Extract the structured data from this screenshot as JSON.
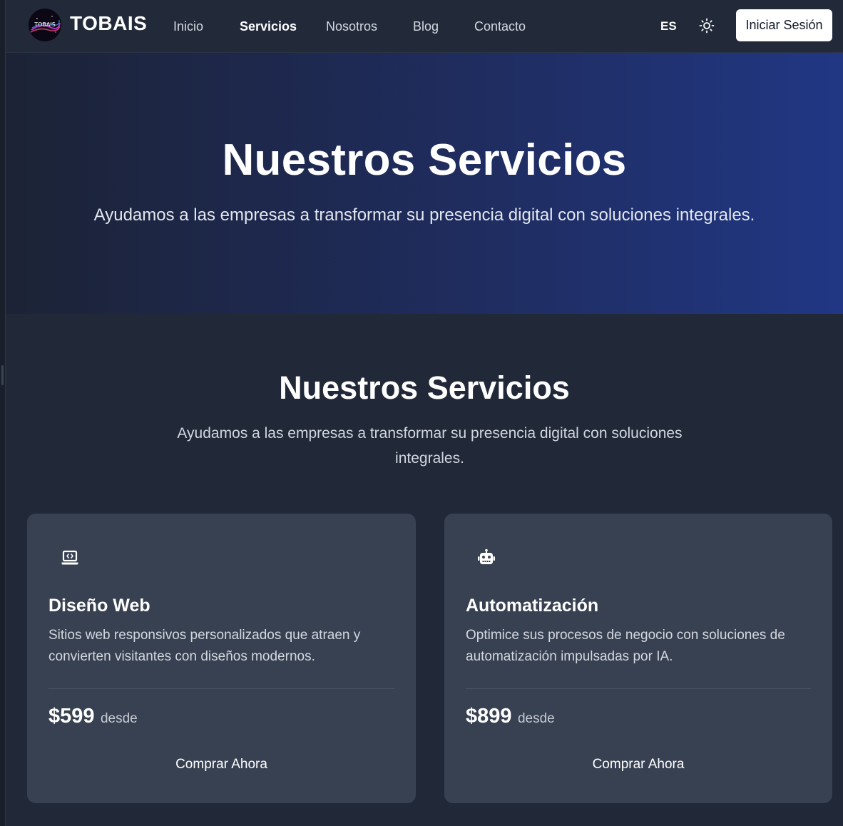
{
  "navbar": {
    "brand": "TOBAIS",
    "logo_text": "TOBAIS",
    "links": [
      {
        "label": "Inicio",
        "active": false
      },
      {
        "label": "Servicios",
        "active": true
      },
      {
        "label": "Nosotros",
        "active": false
      },
      {
        "label": "Blog",
        "active": false
      },
      {
        "label": "Contacto",
        "active": false
      }
    ],
    "language": "ES",
    "theme_icon": "sun-icon",
    "login_label": "Iniciar Sesión"
  },
  "hero": {
    "title": "Nuestros Servicios",
    "subtitle": "Ayudamos a las empresas a transformar su presencia digital con soluciones integrales."
  },
  "services": {
    "title": "Nuestros Servicios",
    "subtitle": "Ayudamos a las empresas a transformar su presencia digital con soluciones integrales.",
    "cards": [
      {
        "icon": "laptop-code-icon",
        "title": "Diseño Web",
        "description": "Sitios web responsivos personalizados que atraen y convierten visitantes con diseños modernos.",
        "price": "$599",
        "price_suffix": "desde",
        "button_label": "Comprar Ahora"
      },
      {
        "icon": "robot-icon",
        "title": "Automatización",
        "description": "Optimice sus procesos de negocio con soluciones de automatización impulsadas por IA.",
        "price": "$899",
        "price_suffix": "desde",
        "button_label": "Comprar Ahora"
      }
    ]
  },
  "colors": {
    "background": "#212938",
    "navbar": "#222a39",
    "card": "#384151",
    "hero_gradient_start": "#1c2336",
    "hero_gradient_end": "#213784",
    "button_light": "#ffffff"
  }
}
